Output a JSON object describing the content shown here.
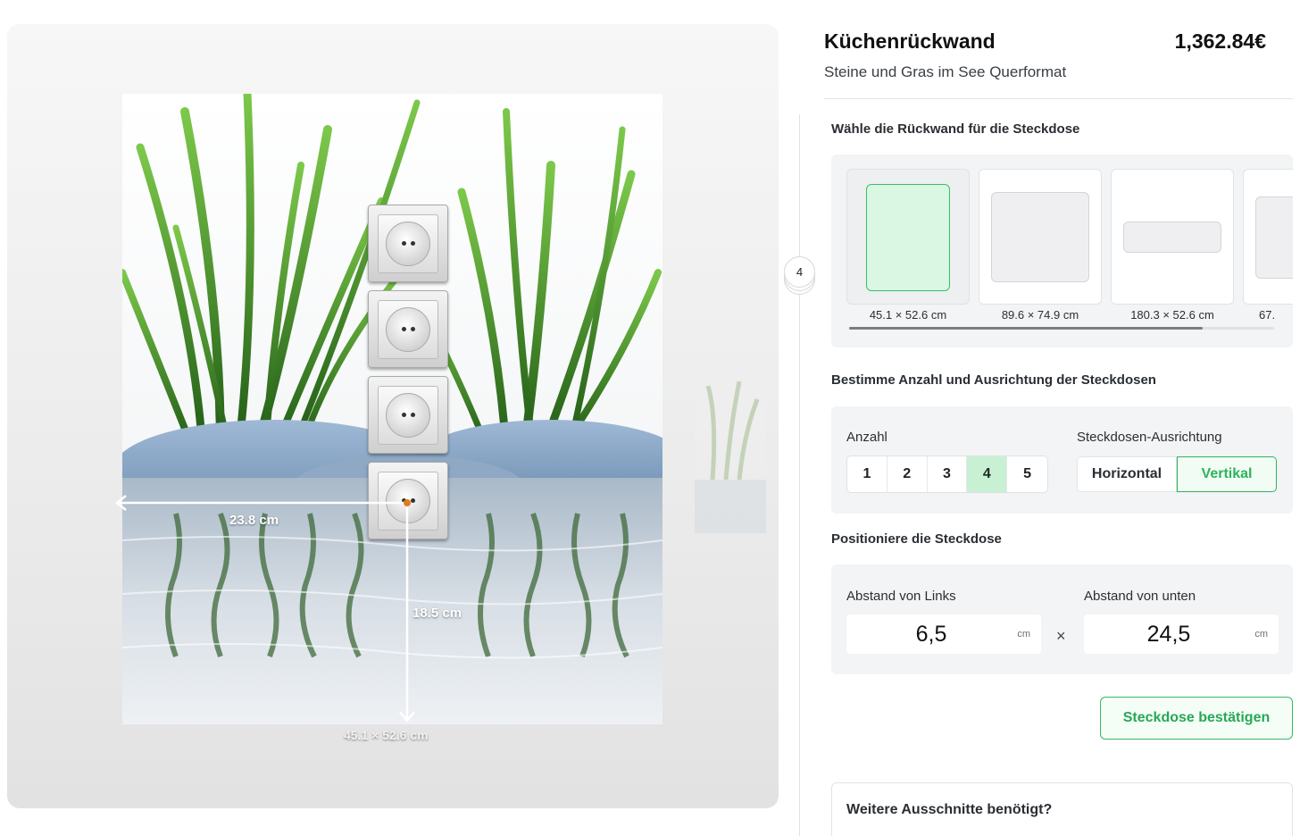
{
  "product": {
    "title": "Küchenrückwand",
    "price": "1,362.84€",
    "subtitle": "Steine und Gras im See Querformat"
  },
  "step_badge": "4",
  "preview": {
    "socket_count": 4,
    "dimension_left": "23.8 cm",
    "dimension_bottom": "18.5 cm",
    "panel_size": "45.1 × 52.6 cm"
  },
  "panel_choice": {
    "title": "Wähle die Rückwand für die Steckdose",
    "options": [
      {
        "label": "45.1 × 52.6 cm",
        "selected": true
      },
      {
        "label": "89.6 × 74.9 cm",
        "selected": false
      },
      {
        "label": "180.3 × 52.6 cm",
        "selected": false
      },
      {
        "label": "67.",
        "selected": false
      }
    ]
  },
  "count_orientation": {
    "title": "Bestimme Anzahl und Ausrichtung der Steckdosen",
    "count_label": "Anzahl",
    "counts": [
      "1",
      "2",
      "3",
      "4",
      "5"
    ],
    "selected_count": "4",
    "orientation_label": "Steckdosen-Ausrichtung",
    "orientations": [
      "Horizontal",
      "Vertikal"
    ],
    "selected_orientation": "Vertikal"
  },
  "position": {
    "title": "Positioniere die Steckdose",
    "left_label": "Abstand von Links",
    "left_value": "6,5",
    "bottom_label": "Abstand von unten",
    "bottom_value": "24,5",
    "unit": "cm",
    "separator": "×"
  },
  "confirm_button": "Steckdose bestätigen",
  "more_cutouts": "Weitere Ausschnitte benötigt?",
  "colors": {
    "accent": "#2fb35d",
    "accent_light": "#c8f1d4"
  }
}
